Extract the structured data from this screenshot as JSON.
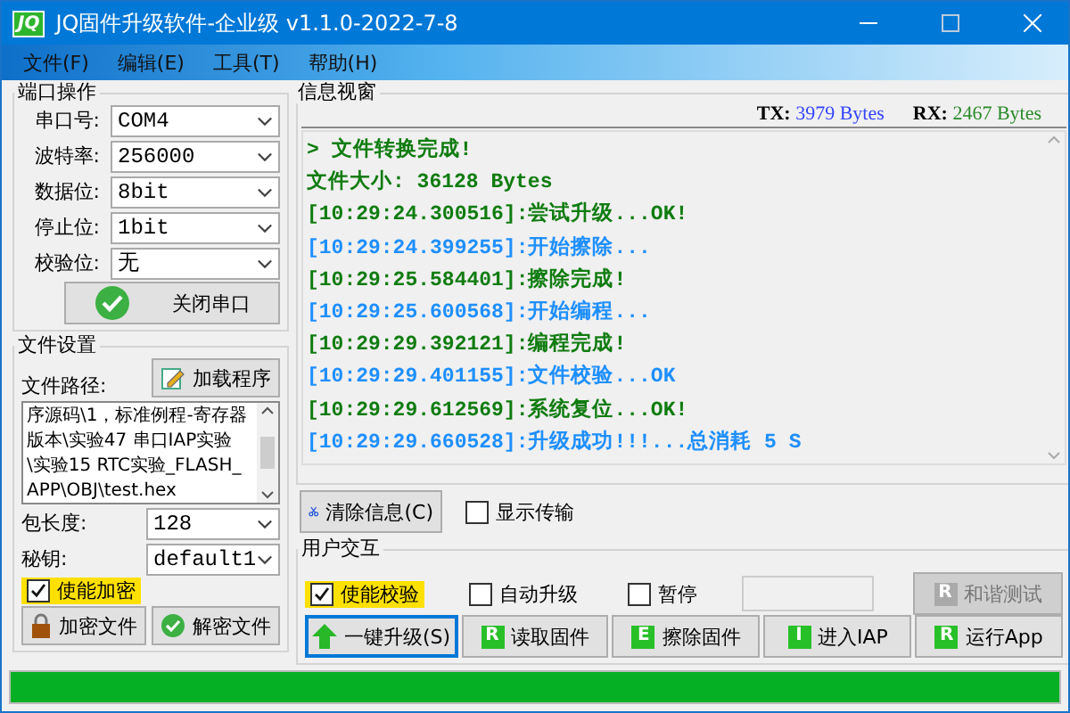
{
  "window": {
    "icon_text": "JQ",
    "title": "JQ固件升级软件-企业级 v1.1.0-2022-7-8"
  },
  "menu": [
    "文件(F)",
    "编辑(E)",
    "工具(T)",
    "帮助(H)"
  ],
  "port_group": {
    "title": "端口操作",
    "fields": [
      {
        "label": "串口号:",
        "value": "COM4"
      },
      {
        "label": "波特率:",
        "value": "256000"
      },
      {
        "label": "数据位:",
        "value": "8bit"
      },
      {
        "label": "停止位:",
        "value": "1bit"
      },
      {
        "label": "校验位:",
        "value": "无"
      }
    ],
    "button": "关闭串口"
  },
  "file_group": {
    "title": "文件设置",
    "path_label": "文件路径:",
    "load_button": "加载程序",
    "path_value": "序源码\\1，标准例程-寄存器版本\\实验47 串口IAP实验\\实验15 RTC实验_FLASH_APP\\OBJ\\test.hex",
    "fields": [
      {
        "label": "包长度:",
        "value": "128"
      },
      {
        "label": "秘钥:",
        "value": "default1"
      }
    ],
    "encrypt": {
      "label": "使能加密",
      "checked": true,
      "highlighted": true
    },
    "buttons": [
      {
        "label": "加密文件",
        "kind": "lock"
      },
      {
        "label": "解密文件",
        "kind": "check"
      }
    ]
  },
  "log": {
    "title": "信息视窗",
    "tx_label": "TX:",
    "tx_value": "3979 Bytes",
    "rx_label": "RX:",
    "rx_value": "2467 Bytes",
    "lines": [
      {
        "text": "> 文件转换完成!",
        "color": "#107c10"
      },
      {
        "text": "文件大小: 36128 Bytes",
        "color": "#107c10"
      },
      {
        "text": "[10:29:24.300516]:尝试升级...OK!",
        "color": "#107c10"
      },
      {
        "text": "[10:29:24.399255]:开始擦除...",
        "color": "#1e8fff"
      },
      {
        "text": "[10:29:25.584401]:擦除完成!",
        "color": "#107c10"
      },
      {
        "text": "[10:29:25.600568]:开始编程...",
        "color": "#1e8fff"
      },
      {
        "text": "[10:29:29.392121]:编程完成!",
        "color": "#107c10"
      },
      {
        "text": "[10:29:29.401155]:文件校验...OK",
        "color": "#1e8fff"
      },
      {
        "text": "[10:29:29.612569]:系统复位...OK!",
        "color": "#107c10"
      },
      {
        "text": "[10:29:29.660528]:升级成功!!!...总消耗 5 S",
        "color": "#1e8fff"
      }
    ]
  },
  "log_controls": {
    "clear_button": "清除信息(C)",
    "show_transfer": {
      "label": "显示传输",
      "checked": false
    }
  },
  "user_group": {
    "title": "用户交互",
    "options": [
      {
        "label": "使能校验",
        "checked": true,
        "highlighted": true
      },
      {
        "label": "自动升级",
        "checked": false,
        "highlighted": false
      },
      {
        "label": "暂停",
        "checked": false,
        "highlighted": false
      }
    ],
    "test_button": {
      "label": "和谐测试",
      "icon_letter": "R",
      "disabled": true
    },
    "buttons": [
      {
        "label": "一键升级(S)",
        "kind": "arrow",
        "focused": true
      },
      {
        "label": "读取固件",
        "kind": "letter",
        "icon_letter": "R",
        "focused": false
      },
      {
        "label": "擦除固件",
        "kind": "letter",
        "icon_letter": "E",
        "focused": false
      },
      {
        "label": "进入IAP",
        "kind": "letter",
        "icon_letter": "I",
        "focused": false
      },
      {
        "label": "运行App",
        "kind": "letter",
        "icon_letter": "R",
        "focused": false
      }
    ]
  },
  "progress": {
    "level": 1
  }
}
